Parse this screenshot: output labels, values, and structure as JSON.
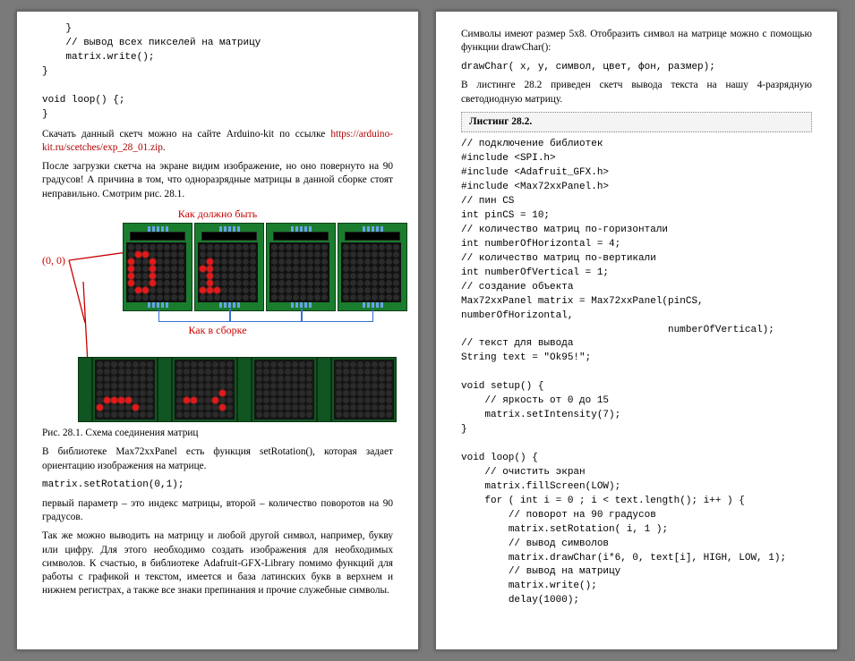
{
  "left": {
    "code_top": "    }\n    // вывод всех пикселей на матрицу\n    matrix.write();\n}\n\nvoid loop() {;\n}",
    "para_download_1": "Скачать данный скетч можно на сайте Arduino-kit по ссылке ",
    "download_link": "https://arduino-kit.ru/scetches/exp_28_01.zip",
    "download_link_tail": ".",
    "para_after_download": "После загрузки скетча на экране видим изображение, но оно повернуто на 90 градусов! А причина в том, что одноразрядные матрицы в данной сборке стоят неправильно. Смотрим рис. 28.1.",
    "fig_label_top": "Как должно быть",
    "fig_origin": "(0, 0)",
    "fig_label_mid": "Как в сборке",
    "fig_caption": "Рис. 28.1. Схема соединения матриц",
    "para_lib1": "В библиотеке Max72xxPanel есть функция setRotation(), которая задает ориентацию изображения на матрице.",
    "code_rot": "matrix.setRotation(0,1);",
    "para_params": "первый параметр – это индекс матрицы, второй – количество поворотов на 90 градусов.",
    "para_symbols": "Так же можно выводить на матрицу и любой другой символ, например, букву или цифру. Для этого необходимо создать изображения для необходимых символов. К счастью, в библиотеке Adafruit-GFX-Library помимо функций для работы с графикой и текстом, имеется и база латинских букв в верхнем и нижнем регистрах, а также все знаки препинания и прочие служебные символы."
  },
  "right": {
    "para_intro": "Символы имеют размер 5х8. Отобразить символ на матрице можно с помощью функции drawChar():",
    "code_drawchar": "drawChar( x, y, символ, цвет, фон, размер);",
    "para_listing_intro": "В листинге 28.2 приведен скетч вывода текста на нашу 4-разрядную светодиодную матрицу.",
    "listing_label": "Листинг 28.2.",
    "code_main": "// подключение библиотек\n#include <SPI.h>\n#include <Adafruit_GFX.h>\n#include <Max72xxPanel.h>\n// пин CS\nint pinCS = 10;\n// количество матриц по-горизонтали\nint numberOfHorizontal = 4;\n// количество матриц по-вертикали\nint numberOfVertical = 1;\n// создание объекта\nMax72xxPanel matrix = Max72xxPanel(pinCS, numberOfHorizontal,\n                                   numberOfVertical);\n// текст для вывода\nString text = \"Ok95!\";\n\nvoid setup() {\n    // яркость от 0 до 15\n    matrix.setIntensity(7);\n}\n\nvoid loop() {\n    // очистить экран\n    matrix.fillScreen(LOW);\n    for ( int i = 0 ; i < text.length(); i++ ) {\n        // поворот на 90 градусов\n        matrix.setRotation( i, 1 );\n        // вывод символов\n        matrix.drawChar(i*6, 0, text[i], HIGH, LOW, 1);\n        // вывод на матрицу\n        matrix.write();\n        delay(1000);"
  },
  "fig1_patterns": [
    [
      0,
      0,
      0,
      0,
      0,
      0,
      0,
      0,
      0,
      1,
      1,
      0,
      0,
      0,
      0,
      0,
      1,
      0,
      0,
      1,
      0,
      0,
      0,
      0,
      1,
      0,
      0,
      1,
      0,
      0,
      0,
      0,
      1,
      0,
      0,
      1,
      0,
      0,
      0,
      0,
      1,
      0,
      0,
      1,
      0,
      0,
      0,
      0,
      0,
      1,
      1,
      0,
      0,
      0,
      0,
      0,
      0,
      0,
      0,
      0,
      0,
      0,
      0,
      0
    ],
    [
      0,
      0,
      0,
      0,
      0,
      0,
      0,
      0,
      0,
      0,
      0,
      0,
      0,
      0,
      0,
      0,
      0,
      1,
      0,
      0,
      0,
      0,
      0,
      0,
      1,
      1,
      0,
      0,
      0,
      0,
      0,
      0,
      0,
      1,
      0,
      0,
      0,
      0,
      0,
      0,
      0,
      1,
      0,
      0,
      0,
      0,
      0,
      0,
      1,
      1,
      1,
      0,
      0,
      0,
      0,
      0,
      0,
      0,
      0,
      0,
      0,
      0,
      0,
      0
    ],
    [
      0,
      0,
      0,
      0,
      0,
      0,
      0,
      0,
      0,
      0,
      0,
      0,
      0,
      0,
      0,
      0,
      0,
      0,
      0,
      0,
      0,
      0,
      0,
      0,
      0,
      0,
      0,
      0,
      0,
      0,
      0,
      0,
      0,
      0,
      0,
      0,
      0,
      0,
      0,
      0,
      0,
      0,
      0,
      0,
      0,
      0,
      0,
      0,
      0,
      0,
      0,
      0,
      0,
      0,
      0,
      0,
      0,
      0,
      0,
      0,
      0,
      0,
      0,
      0
    ],
    [
      0,
      0,
      0,
      0,
      0,
      0,
      0,
      0,
      0,
      0,
      0,
      0,
      0,
      0,
      0,
      0,
      0,
      0,
      0,
      0,
      0,
      0,
      0,
      0,
      0,
      0,
      0,
      0,
      0,
      0,
      0,
      0,
      0,
      0,
      0,
      0,
      0,
      0,
      0,
      0,
      0,
      0,
      0,
      0,
      0,
      0,
      0,
      0,
      0,
      0,
      0,
      0,
      0,
      0,
      0,
      0,
      0,
      0,
      0,
      0,
      0,
      0,
      0,
      0
    ]
  ],
  "fig2_patterns": [
    [
      0,
      0,
      0,
      0,
      0,
      0,
      0,
      0,
      0,
      0,
      0,
      0,
      0,
      0,
      0,
      0,
      0,
      0,
      0,
      0,
      0,
      0,
      0,
      0,
      0,
      0,
      0,
      0,
      0,
      0,
      0,
      0,
      0,
      0,
      0,
      0,
      0,
      0,
      0,
      0,
      0,
      1,
      1,
      1,
      1,
      0,
      0,
      0,
      1,
      0,
      0,
      0,
      0,
      1,
      0,
      0,
      0,
      0,
      0,
      0,
      0,
      0,
      0,
      0
    ],
    [
      0,
      0,
      0,
      0,
      0,
      0,
      0,
      0,
      0,
      0,
      0,
      0,
      0,
      0,
      0,
      0,
      0,
      0,
      0,
      0,
      0,
      0,
      0,
      0,
      0,
      0,
      0,
      0,
      0,
      0,
      0,
      0,
      0,
      0,
      0,
      0,
      0,
      0,
      1,
      0,
      0,
      1,
      1,
      0,
      0,
      1,
      0,
      0,
      0,
      0,
      0,
      0,
      0,
      0,
      1,
      0,
      0,
      0,
      0,
      0,
      0,
      0,
      0,
      0
    ],
    [
      0,
      0,
      0,
      0,
      0,
      0,
      0,
      0,
      0,
      0,
      0,
      0,
      0,
      0,
      0,
      0,
      0,
      0,
      0,
      0,
      0,
      0,
      0,
      0,
      0,
      0,
      0,
      0,
      0,
      0,
      0,
      0,
      0,
      0,
      0,
      0,
      0,
      0,
      0,
      0,
      0,
      0,
      0,
      0,
      0,
      0,
      0,
      0,
      0,
      0,
      0,
      0,
      0,
      0,
      0,
      0,
      0,
      0,
      0,
      0,
      0,
      0,
      0,
      0
    ],
    [
      0,
      0,
      0,
      0,
      0,
      0,
      0,
      0,
      0,
      0,
      0,
      0,
      0,
      0,
      0,
      0,
      0,
      0,
      0,
      0,
      0,
      0,
      0,
      0,
      0,
      0,
      0,
      0,
      0,
      0,
      0,
      0,
      0,
      0,
      0,
      0,
      0,
      0,
      0,
      0,
      0,
      0,
      0,
      0,
      0,
      0,
      0,
      0,
      0,
      0,
      0,
      0,
      0,
      0,
      0,
      0,
      0,
      0,
      0,
      0,
      0,
      0,
      0,
      0
    ]
  ]
}
